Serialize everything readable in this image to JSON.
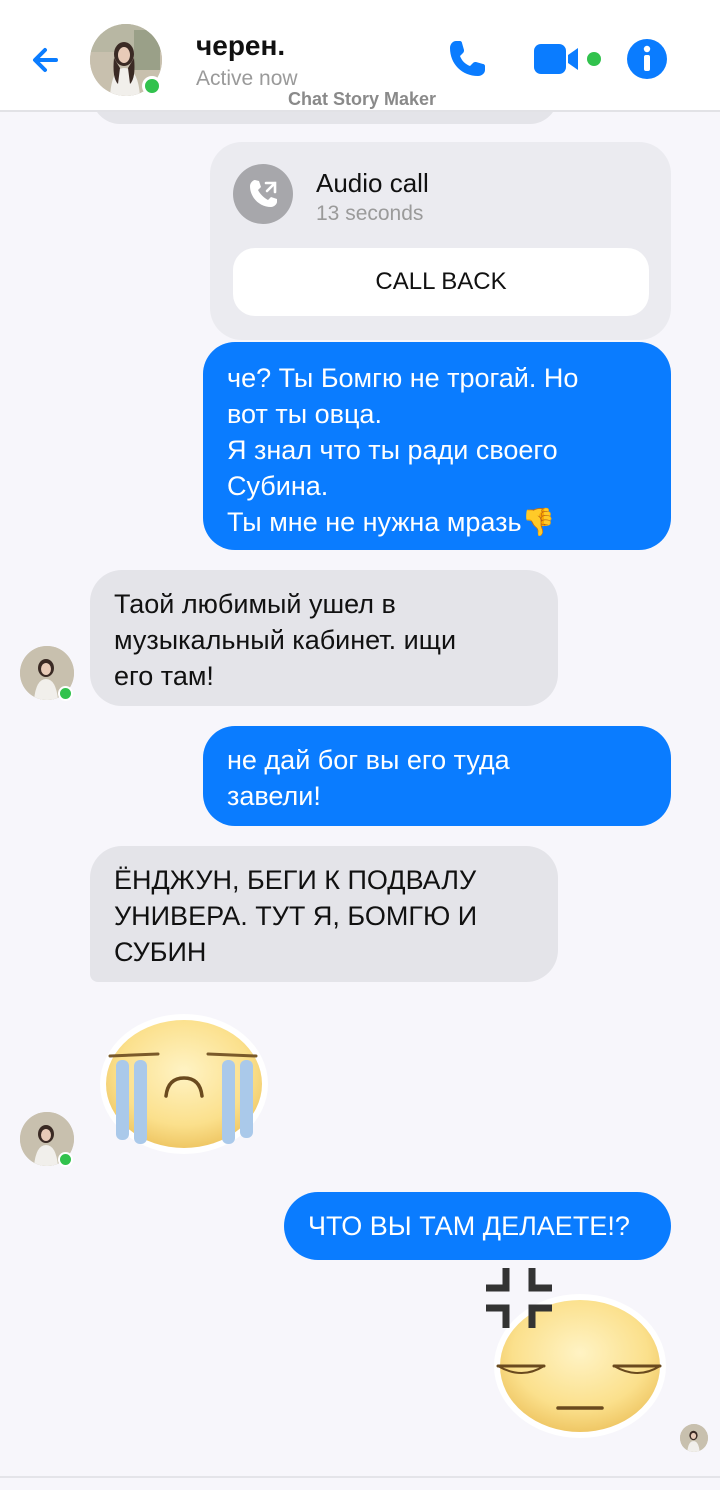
{
  "header": {
    "contact_name": "черен.",
    "status": "Active now",
    "watermark": "Chat Story Maker",
    "icons": [
      "back-arrow-icon",
      "phone-icon",
      "video-camera-icon",
      "info-icon"
    ]
  },
  "call_card": {
    "title": "Audio call",
    "duration": "13 seconds",
    "button_label": "CALL BACK"
  },
  "messages": [
    {
      "side": "out",
      "text": "че? Ты Бомгю не трогай. Но\nвот ты овца.\nЯ знал что ты ради своего\nСубина.\nТы мне не нужна мразь",
      "emoji": "👎"
    },
    {
      "side": "in",
      "text": "Таой любимый ушел в\nмузыкальный кабинет. ищи\nего там!"
    },
    {
      "side": "out",
      "text": "не дай бог вы его туда\nзавели!"
    },
    {
      "side": "in",
      "text": "ЁНДЖУН,  БЕГИ К ПОДВАЛУ\nУНИВЕРА. ТУТ Я, БОМГЮ И\nСУБИН"
    },
    {
      "side": "in",
      "sticker": "crying-face-sticker"
    },
    {
      "side": "out",
      "text": "ЧТО ВЫ ТАМ ДЕЛАЕТЕ!?"
    },
    {
      "side": "out",
      "sticker": "angry-face-sticker"
    }
  ],
  "colors": {
    "accent": "#0a7cff",
    "incoming_bubble": "#e4e4e9",
    "online": "#31c24d",
    "background": "#f7f6fb"
  }
}
